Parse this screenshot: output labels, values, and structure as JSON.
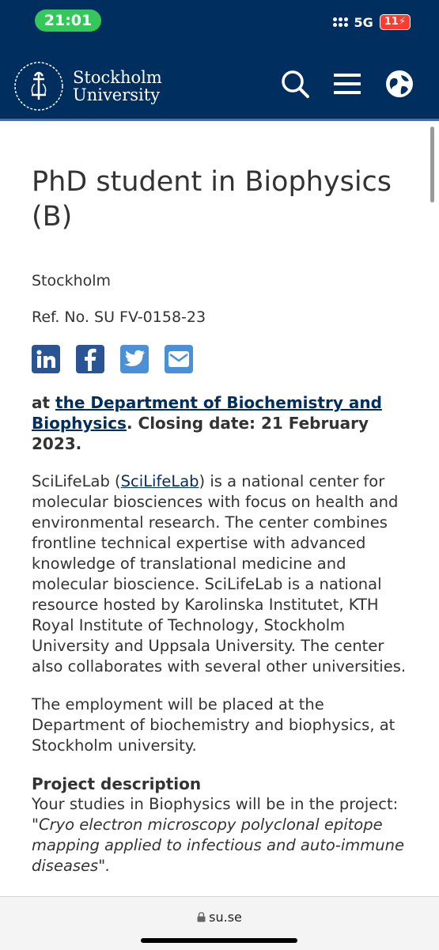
{
  "status_bar": {
    "time": "21:01",
    "network": "5G",
    "battery": "11"
  },
  "header": {
    "logo_line1": "Stockholm",
    "logo_line2": "University",
    "icons": [
      "search-icon",
      "menu-icon",
      "globe-icon"
    ],
    "bg_color": "#002f5f"
  },
  "job": {
    "title": "PhD student in Biophysics (B)",
    "location": "Stockholm",
    "ref_no": "Ref. No. SU FV-0158-23",
    "lead_prefix": "at ",
    "lead_link": "the Department of Biochemistry and Biophysics",
    "lead_suffix": ". Closing date: 21 February 2023."
  },
  "share": [
    "linkedin-icon",
    "facebook-icon",
    "twitter-icon",
    "email-icon"
  ],
  "body": {
    "p1_pre": "SciLifeLab (",
    "p1_link": "SciLifeLab",
    "p1_post": ") is a national center for molecular biosciences with focus on health and environmental research. The center combines frontline technical expertise with advanced knowledge of translational medicine and molecular bioscience. SciLifeLab is a national resource hosted by Karolinska Institutet, KTH Royal Institute of Technology, Stockholm University and Uppsala University. The center also collaborates with several other universities.",
    "p2": "The employment will be placed at the Department of biochemistry and biophysics, at Stockholm university.",
    "section_title": "Project description",
    "p3_pre": "Your studies in Biophysics will be in the project: ",
    "p3_italic": "\"Cryo electron microscopy polyclonal epitope mapping applied to infectious and auto-immune diseases\"."
  },
  "browser": {
    "url": "su.se"
  }
}
